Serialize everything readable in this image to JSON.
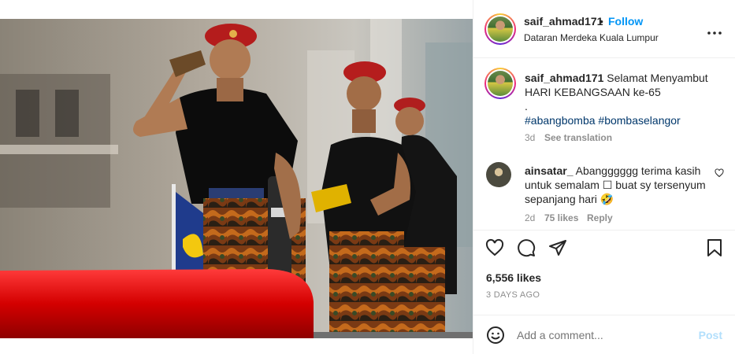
{
  "post": {
    "username": "saif_ahmad171",
    "separator": "•",
    "follow_label": "Follow",
    "location": "Dataran Merdeka Kuala Lumpur",
    "more_label": "•••"
  },
  "caption": {
    "username": "saif_ahmad171",
    "line1": "Selamat Menyambut",
    "line2": "HARI KEBANGSAAN ke-65",
    "line3": ".",
    "hashtags": "#abangbomba #bombaselangor",
    "age": "3d",
    "see_translation": "See translation"
  },
  "comment": {
    "username": "ainsatar_",
    "text_line1": "Abangggggg terima kasih",
    "text_line2": "untuk semalam ☐ buat sy tersenyum",
    "text_line3": "sepanjang hari 🤣",
    "age": "2d",
    "likes": "75 likes",
    "reply_label": "Reply"
  },
  "stats": {
    "likes": "6,556 likes",
    "date": "3 DAYS AGO"
  },
  "composer": {
    "placeholder": "Add a comment...",
    "post_label": "Post"
  },
  "colors": {
    "accent": "#0095f6",
    "hashtag": "#00376b",
    "muted": "#8e8e8e",
    "post_disabled": "#b2dffc"
  },
  "icons": [
    "more-icon",
    "heart-icon",
    "comment-icon",
    "share-icon",
    "bookmark-icon",
    "emoji-icon",
    "small-heart-icon"
  ]
}
